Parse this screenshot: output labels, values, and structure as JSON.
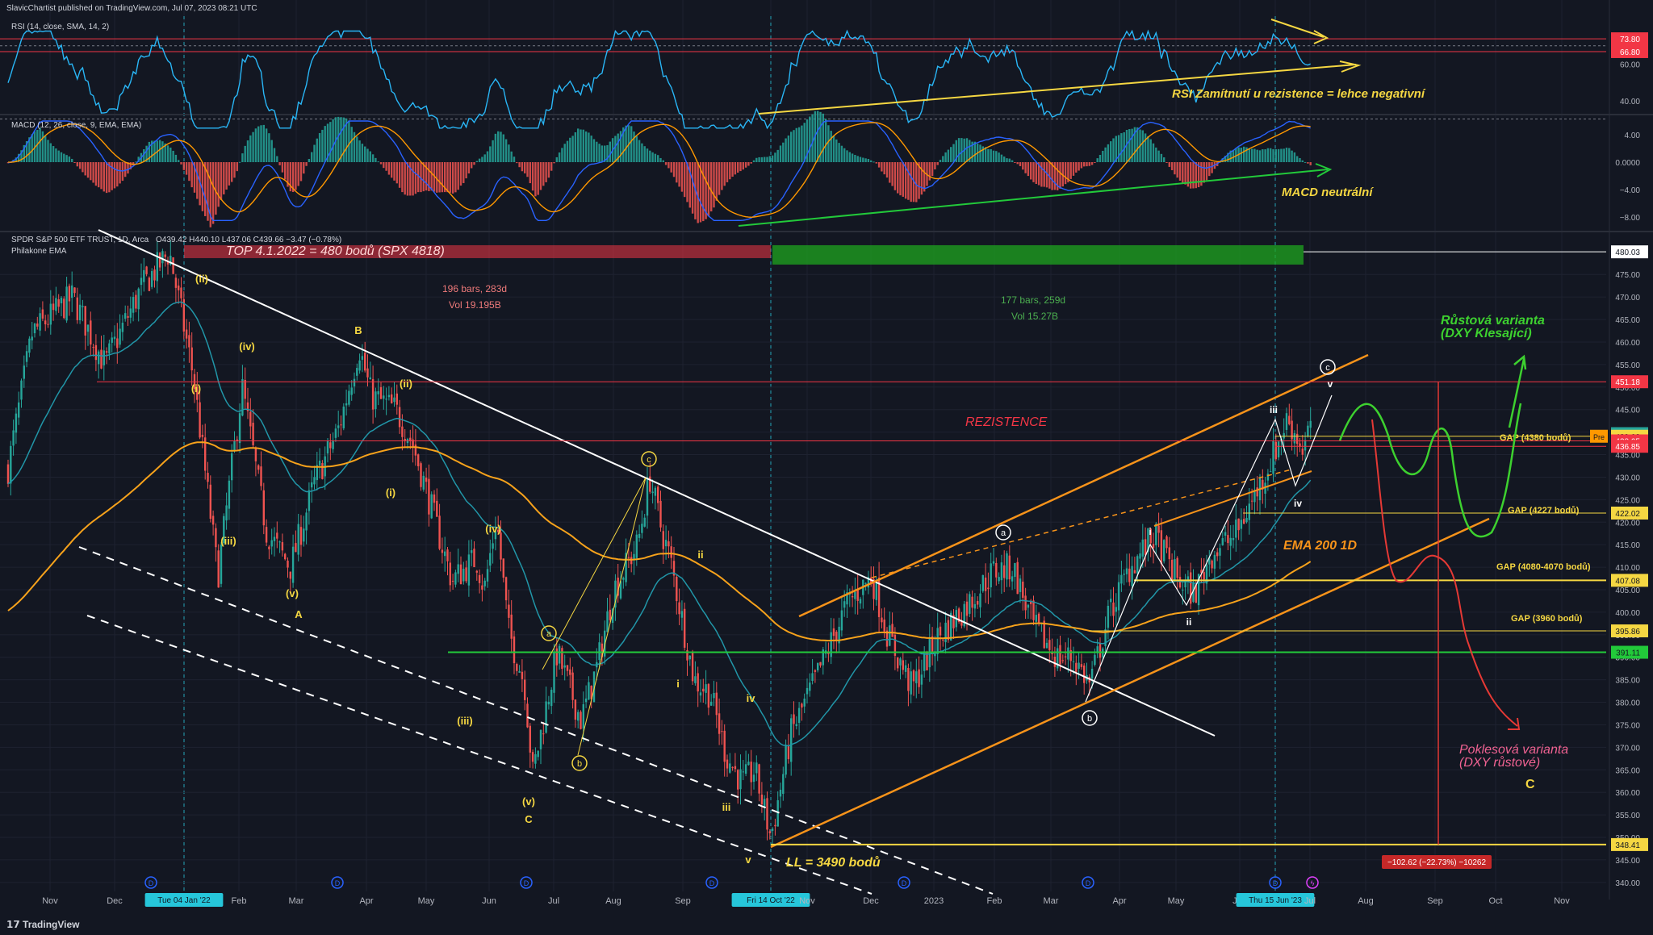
{
  "header": {
    "published": "SlavicChartist published on TradingView.com, Jul 07, 2023 08:21 UTC",
    "rsi_legend": "RSI (14, close, SMA, 14, 2)",
    "macd_legend": "MACD (12, 26, close, 9, EMA, EMA)",
    "symbol_legend": "SPDR S&P 500 ETF TRUST, 1D, Arca",
    "ohlc": "O439.42 H440.10 L437.06 C439.66 −3.47 (−0.78%)",
    "indicator_legend": "Philakone EMA",
    "footer_brand": "TradingView"
  },
  "colors": {
    "background": "#131722",
    "grid": "#1e2230",
    "up_candle": "#26a69a",
    "down_candle": "#ef5350",
    "rsi_line": "#29b6f6",
    "macd_line": "#2962ff",
    "signal_line": "#ff9800",
    "ema_orange": "#f7a21b",
    "ema_teal": "#2196a8",
    "annotation_yellow": "#f5d742",
    "annotation_green": "#22c93a",
    "annotation_red": "#f23645",
    "trend_white": "#ffffff"
  },
  "chart_data": [
    {
      "type": "line",
      "title": "RSI (14, close, SMA, 14, 2)",
      "y_ticks": [
        "60.00",
        "40.00"
      ],
      "price_labels": [
        "73.80",
        "66.80"
      ],
      "annotation": "RSI Zamítnutí u rezistence = lehce negativní",
      "levels": [
        73.8,
        66.8
      ]
    },
    {
      "type": "bar",
      "title": "MACD (12, 26, close, 9, EMA, EMA)",
      "y_ticks": [
        "4.00",
        "0.0000",
        "−4.00",
        "−8.00"
      ],
      "annotation": "MACD neutrální"
    },
    {
      "type": "line",
      "title": "SPDR S&P 500 ETF TRUST, 1D, Arca",
      "x_ticks": [
        "Nov",
        "Dec",
        "Tue 04 Jan '22",
        "Feb",
        "Mar",
        "Apr",
        "May",
        "Jun",
        "Jul",
        "Aug",
        "Sep",
        "Fri 14 Oct '22",
        "Nov",
        "Dec",
        "2023",
        "Feb",
        "Mar",
        "Apr",
        "May",
        "Jun",
        "Thu 15 Jun '23",
        "Jul",
        "Aug",
        "Sep",
        "Oct",
        "Nov"
      ],
      "y_ticks": [
        "475.00",
        "470.00",
        "465.00",
        "460.00",
        "455.00",
        "450.00",
        "445.00",
        "440.00",
        "435.00",
        "430.00",
        "425.00",
        "420.00",
        "415.00",
        "410.00",
        "405.00",
        "400.00",
        "395.00",
        "390.00",
        "385.00",
        "380.00",
        "375.00",
        "370.00",
        "365.00",
        "360.00",
        "355.00",
        "350.00",
        "345.00",
        "340.00"
      ],
      "ylim": [
        338,
        484
      ],
      "price_tags": [
        {
          "label": "480.03",
          "value": 480.03,
          "bg": "#ffffff",
          "fg": "#131722"
        },
        {
          "label": "451.18",
          "value": 451.18,
          "bg": "#f23645",
          "fg": "#ffffff"
        },
        {
          "label": "439.66",
          "value": 439.66,
          "bg": "#26a69a",
          "fg": "#ffffff"
        },
        {
          "label": "439.08",
          "value": 439.08,
          "bg": "#f5d742",
          "fg": "#131722"
        },
        {
          "label": "438.05",
          "value": 438.05,
          "bg": "#f23645",
          "fg": "#ffffff"
        },
        {
          "label": "436.85",
          "value": 436.85,
          "bg": "#f23645",
          "fg": "#ffffff"
        },
        {
          "label": "422.02",
          "value": 422.02,
          "bg": "#f5d742",
          "fg": "#131722"
        },
        {
          "label": "407.08",
          "value": 407.08,
          "bg": "#f5d742",
          "fg": "#131722"
        },
        {
          "label": "395.86",
          "value": 395.86,
          "bg": "#f5d742",
          "fg": "#131722"
        },
        {
          "label": "391.11",
          "value": 391.11,
          "bg": "#22c93a",
          "fg": "#131722"
        },
        {
          "label": "348.41",
          "value": 348.41,
          "bg": "#f5d742",
          "fg": "#131722"
        }
      ],
      "pre_tag": "Pre",
      "top_label": "TOP 4.1.2022 = 480 bodů (SPX 4818)",
      "range_red": {
        "bars": "196 bars, 283d",
        "vol": "Vol 19.195B"
      },
      "range_green": {
        "bars": "177 bars, 259d",
        "vol": "Vol 15.27B"
      },
      "resistance_label": "REZISTENCE",
      "ema_label": "EMA 200 1D",
      "low_label": "LL = 3490 bodů",
      "gaps": [
        "GAP (4380 bodů)",
        "GAP (4227 bodů)",
        "GAP (4080-4070 bodů)",
        "GAP (3960 bodů)"
      ],
      "bull_scenario": [
        "Růstová varianta",
        "(DXY Klesající)"
      ],
      "bear_scenario": [
        "Poklesová varianta",
        "(DXY růstové)"
      ],
      "measure_label": "−102.62 (−22.73%) −10262",
      "wave_labels_yellow": [
        "(ii)",
        "(i)",
        "(iv)",
        "(iii)",
        "(v)",
        "A",
        "B",
        "(ii)",
        "(i)",
        "(iv)",
        "(iii)",
        "(v)",
        "C",
        "ii",
        "i",
        "iv",
        "iii",
        "v",
        "C"
      ],
      "wave_labels_white": [
        "i",
        "ii",
        "iii",
        "iv",
        "v"
      ],
      "circled_labels": [
        "a",
        "b",
        "c",
        "a",
        "b",
        "c"
      ],
      "key_prices": {
        "top": 480.03,
        "bottom": 348.41,
        "last": 439.66
      }
    }
  ]
}
